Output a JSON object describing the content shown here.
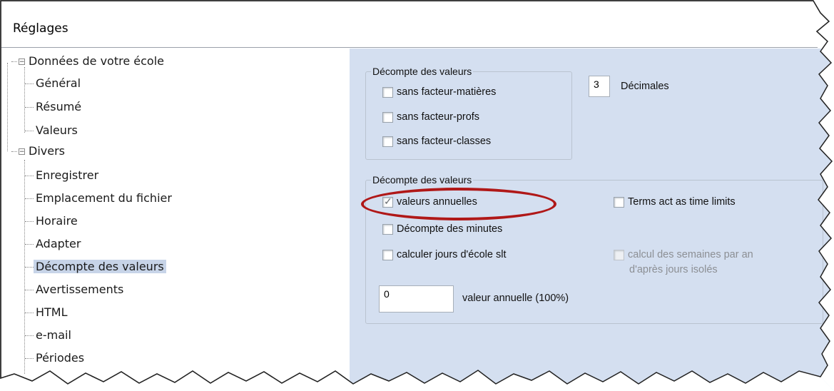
{
  "window": {
    "title": "Réglages"
  },
  "tree": {
    "items": [
      {
        "label": "Données de votre école",
        "level": 0,
        "expander": "−"
      },
      {
        "label": "Général",
        "level": 1
      },
      {
        "label": "Résumé",
        "level": 1
      },
      {
        "label": "Valeurs",
        "level": 1
      },
      {
        "label": "Divers",
        "level": 0,
        "expander": "−"
      },
      {
        "label": "Enregistrer",
        "level": 1
      },
      {
        "label": "Emplacement du fichier",
        "level": 1
      },
      {
        "label": "Horaire",
        "level": 1
      },
      {
        "label": "Adapter",
        "level": 1
      },
      {
        "label": "Décompte des valeurs",
        "level": 1,
        "selected": true
      },
      {
        "label": "Avertissements",
        "level": 1
      },
      {
        "label": "HTML",
        "level": 1
      },
      {
        "label": "e-mail",
        "level": 1
      },
      {
        "label": "Périodes",
        "level": 1
      }
    ]
  },
  "group1": {
    "title": "Décompte des valeurs",
    "checkboxes": [
      {
        "label": "sans facteur-matières",
        "checked": false
      },
      {
        "label": "sans facteur-profs",
        "checked": false
      },
      {
        "label": "sans facteur-classes",
        "checked": false
      }
    ]
  },
  "decimals": {
    "value": "3",
    "label": "Décimales"
  },
  "group2": {
    "title": "Décompte des valeurs",
    "checkboxes": {
      "valeurs_annuelles": {
        "label": "valeurs annuelles",
        "checked": true
      },
      "terms": {
        "label": "Terms act as time limits",
        "checked": false
      },
      "minutes": {
        "label": "Décompte des minutes",
        "checked": false
      },
      "jours_ecole": {
        "label": "calculer jours d'école slt",
        "checked": false
      },
      "semaines": {
        "label": "calcul des semaines par an",
        "label2": "d'après jours isolés",
        "checked": false,
        "disabled": true
      }
    },
    "annual_value": {
      "value": "0",
      "label": "valeur annuelle (100%)"
    }
  },
  "colors": {
    "panel": "#d4dff0",
    "highlight_oval": "#b01818",
    "selection": "#c7d4e8"
  }
}
